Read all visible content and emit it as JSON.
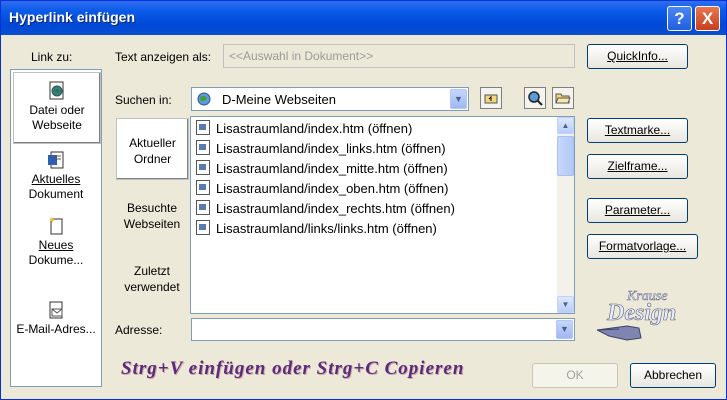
{
  "window": {
    "title": "Hyperlink einfügen",
    "help_label": "?",
    "close_label": "X"
  },
  "link_zu": {
    "label": "Link zu:",
    "items": [
      {
        "label_1": "Datei oder",
        "label_2": "Webseite",
        "icon": "web-file-icon"
      },
      {
        "label_1": "Aktuelles",
        "label_2": "Dokument",
        "icon": "document-icon"
      },
      {
        "label_1": "Neues",
        "label_2": "Dokume...",
        "icon": "new-document-icon"
      },
      {
        "label_1": "E-Mail-Adres...",
        "icon": "email-icon"
      }
    ]
  },
  "text_anzeigen": {
    "label": "Text anzeigen als:",
    "value": "<<Auswahl in Dokument>>"
  },
  "quickinfo_label": "QuickInfo...",
  "suchen_in": {
    "label": "Suchen in:",
    "value": "D-Meine Webseiten",
    "icons": [
      "folder-up-icon",
      "search-web-icon",
      "open-folder-icon"
    ]
  },
  "tabs": [
    {
      "label_1": "Aktueller",
      "label_2": "Ordner"
    },
    {
      "label_1": "Besuchte",
      "label_2": "Webseiten"
    },
    {
      "label_1": "Zuletzt",
      "label_2": "verwendet"
    }
  ],
  "files": [
    "Lisastraumland/index.htm (öffnen)",
    "Lisastraumland/index_links.htm (öffnen)",
    "Lisastraumland/index_mitte.htm (öffnen)",
    "Lisastraumland/index_oben.htm (öffnen)",
    "Lisastraumland/index_rechts.htm (öffnen)",
    "Lisastraumland/links/links.htm (öffnen)"
  ],
  "adresse": {
    "label": "Adresse:",
    "value": ""
  },
  "right_buttons": [
    "Textmarke...",
    "Zielframe...",
    "Parameter...",
    "Formatvorlage..."
  ],
  "banner": "Strg+V  einfügen oder Strg+C  Copieren",
  "ok_label": "OK",
  "cancel_label": "Abbrechen",
  "colors": {
    "title_blue": "#0a5ae8",
    "banner": "#5b2a7a",
    "close_red": "#c93f1f"
  }
}
